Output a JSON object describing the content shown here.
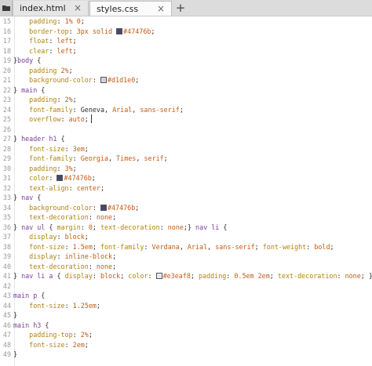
{
  "tabs": [
    {
      "label": "index.html",
      "active": false
    },
    {
      "label": "styles.css",
      "active": true
    }
  ],
  "toolbar": {
    "new_tab_symbol": "+",
    "close_symbol": "×"
  },
  "icons": {
    "folder": "folder-icon"
  },
  "colors": {
    "selector": "#7a3e9d",
    "property": "#b5820a",
    "value": "#c45a14",
    "swatch_47476b": "#47476b",
    "swatch_d1d1e0": "#d1d1e0",
    "swatch_e3eaf8": "#e3eaf8"
  },
  "lines": [
    {
      "n": "15",
      "parts": [
        [
          "prop",
          "    padding"
        ],
        [
          "punct",
          ": "
        ],
        [
          "val",
          "1% 0"
        ],
        [
          "punct",
          ";"
        ]
      ]
    },
    {
      "n": "16",
      "parts": [
        [
          "prop",
          "    border-top"
        ],
        [
          "punct",
          ": "
        ],
        [
          "val",
          "3px solid "
        ],
        [
          "swatch",
          "#47476b"
        ],
        [
          "val",
          "#47476b"
        ],
        [
          "punct",
          ";"
        ]
      ]
    },
    {
      "n": "17",
      "parts": [
        [
          "prop",
          "    float"
        ],
        [
          "punct",
          ": "
        ],
        [
          "val",
          "left"
        ],
        [
          "punct",
          ";"
        ]
      ]
    },
    {
      "n": "18",
      "parts": [
        [
          "prop",
          "    clear"
        ],
        [
          "punct",
          ": "
        ],
        [
          "val",
          "left"
        ],
        [
          "punct",
          ";"
        ]
      ]
    },
    {
      "n": "19",
      "parts": [
        [
          "brace",
          "}"
        ],
        [
          "sel",
          "body"
        ],
        [
          "plain",
          " {"
        ]
      ]
    },
    {
      "n": "20",
      "parts": [
        [
          "prop",
          "    padding"
        ],
        [
          "punct",
          " "
        ],
        [
          "val",
          "2%"
        ],
        [
          "punct",
          ";"
        ]
      ]
    },
    {
      "n": "21",
      "parts": [
        [
          "prop",
          "    background-color"
        ],
        [
          "punct",
          ": "
        ],
        [
          "swatch",
          "#d1d1e0"
        ],
        [
          "val",
          "#d1d1e0"
        ],
        [
          "punct",
          ";"
        ]
      ]
    },
    {
      "n": "22",
      "parts": [
        [
          "brace",
          "} "
        ],
        [
          "sel",
          "main"
        ],
        [
          "plain",
          " {"
        ]
      ]
    },
    {
      "n": "23",
      "parts": [
        [
          "prop",
          "    padding"
        ],
        [
          "punct",
          ": "
        ],
        [
          "val",
          "2%"
        ],
        [
          "punct",
          ";"
        ]
      ]
    },
    {
      "n": "24",
      "parts": [
        [
          "prop",
          "    font-family"
        ],
        [
          "punct",
          ": "
        ],
        [
          "plain",
          "Geneva, "
        ],
        [
          "val",
          "Arial"
        ],
        [
          "plain",
          ", "
        ],
        [
          "val",
          "sans-serif"
        ],
        [
          "punct",
          ";"
        ]
      ]
    },
    {
      "n": "25",
      "parts": [
        [
          "prop",
          "    overflow"
        ],
        [
          "punct",
          ": "
        ],
        [
          "val",
          "auto"
        ],
        [
          "punct",
          ";"
        ],
        [
          "caret",
          ""
        ]
      ]
    },
    {
      "n": "26",
      "parts": []
    },
    {
      "n": "27",
      "parts": [
        [
          "brace",
          "} "
        ],
        [
          "sel",
          "header h1"
        ],
        [
          "plain",
          " {"
        ]
      ]
    },
    {
      "n": "28",
      "parts": [
        [
          "prop",
          "    font-size"
        ],
        [
          "punct",
          ": "
        ],
        [
          "val",
          "3em"
        ],
        [
          "punct",
          ";"
        ]
      ]
    },
    {
      "n": "29",
      "parts": [
        [
          "prop",
          "    font-family"
        ],
        [
          "punct",
          ": "
        ],
        [
          "val",
          "Georgia"
        ],
        [
          "plain",
          ", "
        ],
        [
          "val",
          "Times"
        ],
        [
          "plain",
          ", "
        ],
        [
          "val",
          "serif"
        ],
        [
          "punct",
          ";"
        ]
      ]
    },
    {
      "n": "30",
      "parts": [
        [
          "prop",
          "    padding"
        ],
        [
          "punct",
          ": "
        ],
        [
          "val",
          "3%"
        ],
        [
          "punct",
          ";"
        ]
      ]
    },
    {
      "n": "31",
      "parts": [
        [
          "prop",
          "    color"
        ],
        [
          "punct",
          ": "
        ],
        [
          "swatch",
          "#47476b"
        ],
        [
          "val",
          "#47476b"
        ],
        [
          "punct",
          ";"
        ]
      ]
    },
    {
      "n": "32",
      "parts": [
        [
          "prop",
          "    text-align"
        ],
        [
          "punct",
          ": "
        ],
        [
          "val",
          "center"
        ],
        [
          "punct",
          ";"
        ]
      ]
    },
    {
      "n": "33",
      "parts": [
        [
          "brace",
          "} "
        ],
        [
          "sel",
          "nav"
        ],
        [
          "plain",
          " {"
        ]
      ]
    },
    {
      "n": "34",
      "parts": [
        [
          "prop",
          "    background-color"
        ],
        [
          "punct",
          ": "
        ],
        [
          "swatch",
          "#47476b"
        ],
        [
          "val",
          "#47476b"
        ],
        [
          "punct",
          ";"
        ]
      ]
    },
    {
      "n": "35",
      "parts": [
        [
          "prop",
          "    text-decoration"
        ],
        [
          "punct",
          ": "
        ],
        [
          "val",
          "none"
        ],
        [
          "punct",
          ";"
        ]
      ]
    },
    {
      "n": "36",
      "parts": [
        [
          "brace",
          "} "
        ],
        [
          "sel",
          "nav ul"
        ],
        [
          "plain",
          " { "
        ],
        [
          "prop",
          "margin"
        ],
        [
          "punct",
          ": "
        ],
        [
          "val",
          "0"
        ],
        [
          "punct",
          "; "
        ],
        [
          "prop",
          "text-decoration"
        ],
        [
          "punct",
          ": "
        ],
        [
          "val",
          "none"
        ],
        [
          "punct",
          ";} "
        ],
        [
          "sel",
          "nav li"
        ],
        [
          "plain",
          " {"
        ]
      ]
    },
    {
      "n": "37",
      "parts": [
        [
          "prop",
          "    display"
        ],
        [
          "punct",
          ": "
        ],
        [
          "val",
          "block"
        ],
        [
          "punct",
          ";"
        ]
      ]
    },
    {
      "n": "38",
      "parts": [
        [
          "prop",
          "    font-size"
        ],
        [
          "punct",
          ": "
        ],
        [
          "val",
          "1.5em"
        ],
        [
          "punct",
          "; "
        ],
        [
          "prop",
          "font-family"
        ],
        [
          "punct",
          ": "
        ],
        [
          "val",
          "Verdana"
        ],
        [
          "plain",
          ", "
        ],
        [
          "val",
          "Arial"
        ],
        [
          "plain",
          ", "
        ],
        [
          "val",
          "sans-serif"
        ],
        [
          "punct",
          "; "
        ],
        [
          "prop",
          "font-weight"
        ],
        [
          "punct",
          ": "
        ],
        [
          "val",
          "bold"
        ],
        [
          "punct",
          ";"
        ]
      ]
    },
    {
      "n": "39",
      "parts": [
        [
          "prop",
          "    display"
        ],
        [
          "punct",
          ": "
        ],
        [
          "val",
          "inline-block"
        ],
        [
          "punct",
          ";"
        ]
      ]
    },
    {
      "n": "40",
      "parts": [
        [
          "prop",
          "    text-decoration"
        ],
        [
          "punct",
          ": "
        ],
        [
          "val",
          "none"
        ],
        [
          "punct",
          ";"
        ]
      ]
    },
    {
      "n": "41",
      "parts": [
        [
          "brace",
          "} "
        ],
        [
          "sel",
          "nav li a"
        ],
        [
          "plain",
          " { "
        ],
        [
          "prop",
          "display"
        ],
        [
          "punct",
          ": "
        ],
        [
          "val",
          "block"
        ],
        [
          "punct",
          "; "
        ],
        [
          "prop",
          "color"
        ],
        [
          "punct",
          ": "
        ],
        [
          "swatch",
          "#e3eaf8"
        ],
        [
          "val",
          "#e3eaf8"
        ],
        [
          "punct",
          "; "
        ],
        [
          "prop",
          "padding"
        ],
        [
          "punct",
          ": "
        ],
        [
          "val",
          "0.5em 2em"
        ],
        [
          "punct",
          "; "
        ],
        [
          "prop",
          "text-decoration"
        ],
        [
          "punct",
          ": "
        ],
        [
          "val",
          "none"
        ],
        [
          "punct",
          "; }"
        ]
      ]
    },
    {
      "n": "42",
      "parts": []
    },
    {
      "n": "43",
      "parts": [
        [
          "sel",
          "main p"
        ],
        [
          "plain",
          " {"
        ]
      ]
    },
    {
      "n": "44",
      "parts": [
        [
          "prop",
          "    font-size"
        ],
        [
          "punct",
          ": "
        ],
        [
          "val",
          "1.25em"
        ],
        [
          "punct",
          ";"
        ]
      ]
    },
    {
      "n": "45",
      "parts": [
        [
          "brace",
          "}"
        ]
      ]
    },
    {
      "n": "46",
      "parts": [
        [
          "sel",
          "main h3"
        ],
        [
          "plain",
          " {"
        ]
      ]
    },
    {
      "n": "47",
      "parts": [
        [
          "prop",
          "    padding-top"
        ],
        [
          "punct",
          ": "
        ],
        [
          "val",
          "2%"
        ],
        [
          "punct",
          ";"
        ]
      ]
    },
    {
      "n": "48",
      "parts": [
        [
          "prop",
          "    font-size"
        ],
        [
          "punct",
          ": "
        ],
        [
          "val",
          "2em"
        ],
        [
          "punct",
          ";"
        ]
      ]
    },
    {
      "n": "49",
      "parts": [
        [
          "brace",
          "}"
        ]
      ]
    }
  ]
}
